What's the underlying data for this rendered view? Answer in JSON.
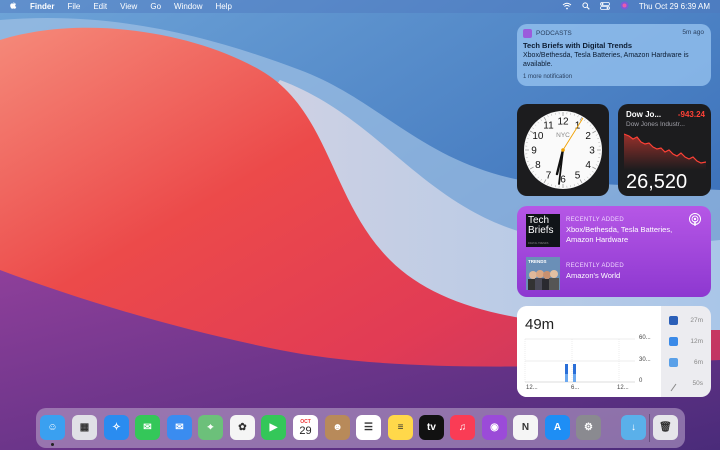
{
  "menubar": {
    "app": "Finder",
    "menus": [
      "File",
      "Edit",
      "View",
      "Go",
      "Window",
      "Help"
    ],
    "clock": "Thu Oct 29  6:39 AM"
  },
  "notification": {
    "app": "PODCASTS",
    "time": "5m ago",
    "title": "Tech Briefs with Digital Trends",
    "body": "Xbox/Bethesda, Tesla Batteries, Amazon Hardware is available.",
    "more": "1 more notification"
  },
  "clock_widget": {
    "city": "NYC",
    "numerals": [
      "12",
      "1",
      "2",
      "3",
      "4",
      "5",
      "6",
      "7",
      "8",
      "9",
      "10",
      "11"
    ]
  },
  "stocks_widget": {
    "symbol": "Dow Jo...",
    "change": "-943.24",
    "name": "Dow Jones Industr...",
    "value": "26,520",
    "color": "#ff4136"
  },
  "podcasts_widget": {
    "items": [
      {
        "label": "RECENTLY ADDED",
        "title": "Xbox/Bethesda, Tesla Batteries, Amazon Hardware",
        "art_title": "Tech Briefs",
        "art_sub": "DIGITAL TRENDS"
      },
      {
        "label": "RECENTLY ADDED",
        "title": "Amazon's World",
        "art_title": "TRENDS"
      }
    ]
  },
  "screentime_widget": {
    "total": "49m",
    "y_labels": [
      "60...",
      "30...",
      "0"
    ],
    "x_labels": [
      "12...",
      "6...",
      "12..."
    ],
    "apps": [
      {
        "icon": "word-icon",
        "time": "27m",
        "color": "#2b5fb8"
      },
      {
        "icon": "finder-icon",
        "time": "12m",
        "color": "#3a8ae8"
      },
      {
        "icon": "preview-icon",
        "time": "6m",
        "color": "#5aa0e8"
      },
      {
        "icon": "pen-icon",
        "time": "50s",
        "color": "#888888"
      }
    ]
  },
  "dock": {
    "apps": [
      {
        "name": "finder-icon",
        "color": "#3aa0f0",
        "glyph": "☺",
        "running": true
      },
      {
        "name": "launchpad-icon",
        "color": "#e0e0e6",
        "glyph": "▦"
      },
      {
        "name": "safari-icon",
        "color": "#2a8cf0",
        "glyph": "✧"
      },
      {
        "name": "messages-icon",
        "color": "#34c759",
        "glyph": "✉"
      },
      {
        "name": "mail-icon",
        "color": "#3a8cf0",
        "glyph": "✉"
      },
      {
        "name": "maps-icon",
        "color": "#6cc07a",
        "glyph": "⌖"
      },
      {
        "name": "photos-icon",
        "color": "#f5f5f5",
        "glyph": "✿"
      },
      {
        "name": "facetime-icon",
        "color": "#34c759",
        "glyph": "▶"
      },
      {
        "name": "calendar-icon",
        "color": "#ffffff",
        "glyph": "29",
        "label": "OCT"
      },
      {
        "name": "contacts-icon",
        "color": "#b88a5a",
        "glyph": "☻"
      },
      {
        "name": "reminders-icon",
        "color": "#ffffff",
        "glyph": "☰"
      },
      {
        "name": "notes-icon",
        "color": "#ffd84a",
        "glyph": "≡"
      },
      {
        "name": "tv-icon",
        "color": "#111111",
        "glyph": "tv"
      },
      {
        "name": "music-icon",
        "color": "#fa3c55",
        "glyph": "♫"
      },
      {
        "name": "podcasts-icon",
        "color": "#9b4bd8",
        "glyph": "◉"
      },
      {
        "name": "news-icon",
        "color": "#f5f5f5",
        "glyph": "N"
      },
      {
        "name": "app-store-icon",
        "color": "#1e8ef5",
        "glyph": "A"
      },
      {
        "name": "system-preferences-icon",
        "color": "#8a8a90",
        "glyph": "⚙"
      },
      {
        "name": "downloads-folder-icon",
        "color": "#5ab0ea",
        "glyph": "↓"
      },
      {
        "name": "trash-icon",
        "color": "#e6e6ea",
        "glyph": "🗑"
      }
    ]
  }
}
